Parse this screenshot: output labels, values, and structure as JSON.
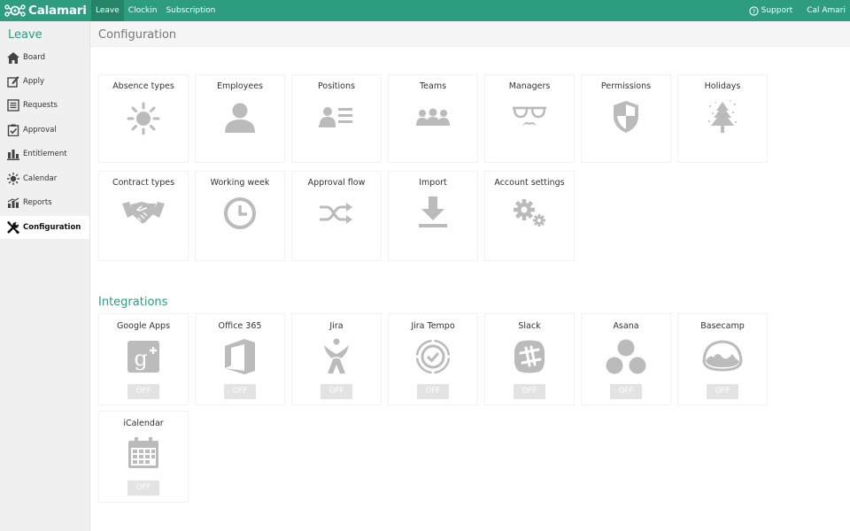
{
  "app": {
    "logo_text": "Calamari",
    "accent": "#2e9c7f"
  },
  "topnav": [
    {
      "label": "Leave",
      "active": true
    },
    {
      "label": "Clockin",
      "active": false
    },
    {
      "label": "Subscription",
      "active": false
    }
  ],
  "topright": {
    "support": "Support",
    "user": "Cal Amari"
  },
  "sidebar": {
    "title": "Leave",
    "items": [
      {
        "label": "Board",
        "icon": "home-icon"
      },
      {
        "label": "Apply",
        "icon": "edit-icon"
      },
      {
        "label": "Requests",
        "icon": "list-icon"
      },
      {
        "label": "Approval",
        "icon": "check-icon"
      },
      {
        "label": "Entitlement",
        "icon": "bars-icon"
      },
      {
        "label": "Calendar",
        "icon": "sun-icon"
      },
      {
        "label": "Reports",
        "icon": "chart-icon"
      },
      {
        "label": "Configuration",
        "icon": "tools-icon",
        "active": true
      }
    ]
  },
  "page": {
    "title": "Configuration"
  },
  "config_cards": [
    {
      "label": "Absence types",
      "icon": "sun-icon"
    },
    {
      "label": "Employees",
      "icon": "person-icon"
    },
    {
      "label": "Positions",
      "icon": "id-card-icon"
    },
    {
      "label": "Teams",
      "icon": "group-icon"
    },
    {
      "label": "Managers",
      "icon": "glasses-mustache-icon"
    },
    {
      "label": "Permissions",
      "icon": "shield-icon"
    },
    {
      "label": "Holidays",
      "icon": "christmas-tree-icon"
    },
    {
      "label": "Contract types",
      "icon": "handshake-icon"
    },
    {
      "label": "Working week",
      "icon": "clock-icon"
    },
    {
      "label": "Approval flow",
      "icon": "shuffle-icon"
    },
    {
      "label": "Import",
      "icon": "download-icon"
    },
    {
      "label": "Account settings",
      "icon": "gears-icon"
    }
  ],
  "integrations": {
    "title": "Integrations",
    "items": [
      {
        "label": "Google Apps",
        "icon": "google-plus-icon",
        "status": "OFF"
      },
      {
        "label": "Office 365",
        "icon": "office-icon",
        "status": "OFF"
      },
      {
        "label": "Jira",
        "icon": "jira-icon",
        "status": "OFF"
      },
      {
        "label": "Jira Tempo",
        "icon": "tempo-icon",
        "status": "OFF"
      },
      {
        "label": "Slack",
        "icon": "slack-icon",
        "status": "OFF"
      },
      {
        "label": "Asana",
        "icon": "asana-icon",
        "status": "OFF"
      },
      {
        "label": "Basecamp",
        "icon": "basecamp-icon",
        "status": "OFF"
      },
      {
        "label": "iCalendar",
        "icon": "calendar-icon",
        "status": "OFF"
      }
    ]
  }
}
